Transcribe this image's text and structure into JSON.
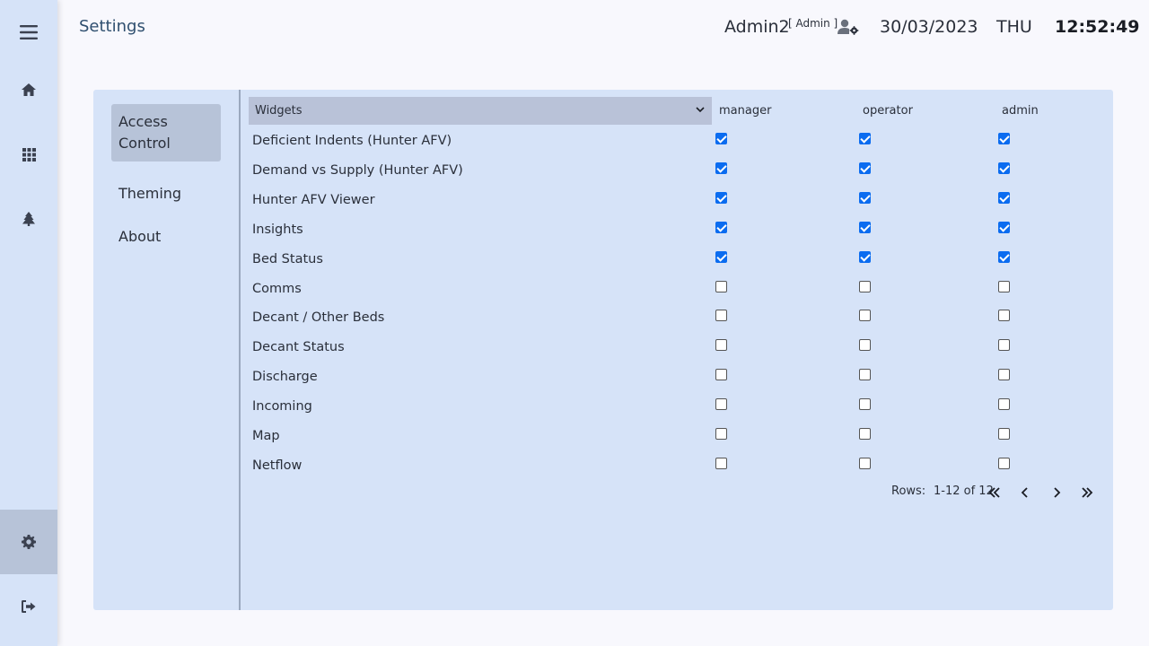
{
  "header": {
    "page_title": "Settings",
    "user_name": "Admin2",
    "user_role": "[ Admin ]",
    "date": "30/03/2023",
    "day": "THU",
    "time": "12:52:49"
  },
  "nav": {
    "items": [
      {
        "icon": "menu-icon"
      },
      {
        "icon": "home-icon"
      },
      {
        "icon": "grid-icon"
      },
      {
        "icon": "tree-icon"
      },
      {
        "icon": "gear-icon",
        "active": true
      },
      {
        "icon": "logout-icon"
      }
    ]
  },
  "settings_menu": [
    {
      "label": "Access Control",
      "active": true
    },
    {
      "label": "Theming"
    },
    {
      "label": "About"
    }
  ],
  "table": {
    "select_label": "Widgets",
    "columns": [
      "manager",
      "operator",
      "admin"
    ],
    "rows": [
      {
        "label": "Deficient Indents (Hunter AFV)",
        "checks": [
          true,
          true,
          true
        ]
      },
      {
        "label": "Demand vs Supply (Hunter AFV)",
        "checks": [
          true,
          true,
          true
        ]
      },
      {
        "label": "Hunter AFV Viewer",
        "checks": [
          true,
          true,
          true
        ]
      },
      {
        "label": "Insights",
        "checks": [
          true,
          true,
          true
        ]
      },
      {
        "label": "Bed Status",
        "checks": [
          true,
          true,
          true
        ]
      },
      {
        "label": "Comms",
        "checks": [
          false,
          false,
          false
        ]
      },
      {
        "label": "Decant / Other Beds",
        "checks": [
          false,
          false,
          false
        ]
      },
      {
        "label": "Decant Status",
        "checks": [
          false,
          false,
          false
        ]
      },
      {
        "label": "Discharge",
        "checks": [
          false,
          false,
          false
        ]
      },
      {
        "label": "Incoming",
        "checks": [
          false,
          false,
          false
        ]
      },
      {
        "label": "Map",
        "checks": [
          false,
          false,
          false
        ]
      },
      {
        "label": "Netflow",
        "checks": [
          false,
          false,
          false
        ]
      }
    ]
  },
  "pager": {
    "rows_label": "Rows:",
    "range": "1-12 of 12"
  },
  "colors": {
    "rail": "#d6e3f8",
    "panel": "#d6e3f8",
    "active": "#b7c3d8",
    "checkbox": "#0b6cf0"
  }
}
